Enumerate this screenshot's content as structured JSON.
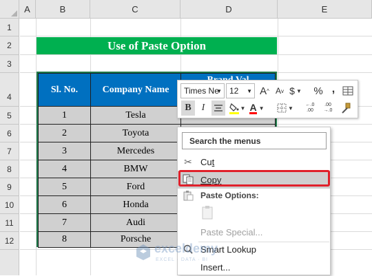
{
  "sheet": {
    "columns": [
      "A",
      "B",
      "C",
      "D",
      "E"
    ],
    "rows": [
      "1",
      "2",
      "3",
      "4",
      "5",
      "6",
      "7",
      "8",
      "9",
      "10",
      "11",
      "12"
    ]
  },
  "title": "Use of Paste Option",
  "table": {
    "headers": [
      "Sl. No.",
      "Company Name",
      "Brand Val"
    ],
    "rows": [
      [
        "1",
        "Tesla"
      ],
      [
        "2",
        "Toyota"
      ],
      [
        "3",
        "Mercedes"
      ],
      [
        "4",
        "BMW"
      ],
      [
        "5",
        "Ford"
      ],
      [
        "6",
        "Honda"
      ],
      [
        "7",
        "Audi"
      ],
      [
        "8",
        "Porsche"
      ]
    ]
  },
  "mini_toolbar": {
    "font_name": "Times Ne",
    "font_size": "12",
    "grow_font": "A",
    "shrink_font": "A",
    "currency": "$",
    "percent": "%",
    "comma": ",",
    "bold": "B",
    "italic": "I",
    "font_color": "A",
    "increase_decimal": "←.0 .00",
    "decrease_decimal": ".00 →.0"
  },
  "context_menu": {
    "search_placeholder": "Search the menus",
    "cut": "Cut",
    "cut_underline": "t",
    "copy": "Copy",
    "copy_underline": "C",
    "paste_options_heading": "Paste Options:",
    "paste_special": "Paste Special...",
    "smart_lookup": "Smart Lookup",
    "insert": "Insert..."
  },
  "watermark": {
    "brand": "exceldemy",
    "tagline": "EXCEL · DATA · BI"
  },
  "colors": {
    "title_bg": "#00b050",
    "header_bg": "#0070c0",
    "cell_bg": "#d0d0d0",
    "highlight_border": "#e0202a",
    "copy_highlight": "#cfcfcf"
  }
}
